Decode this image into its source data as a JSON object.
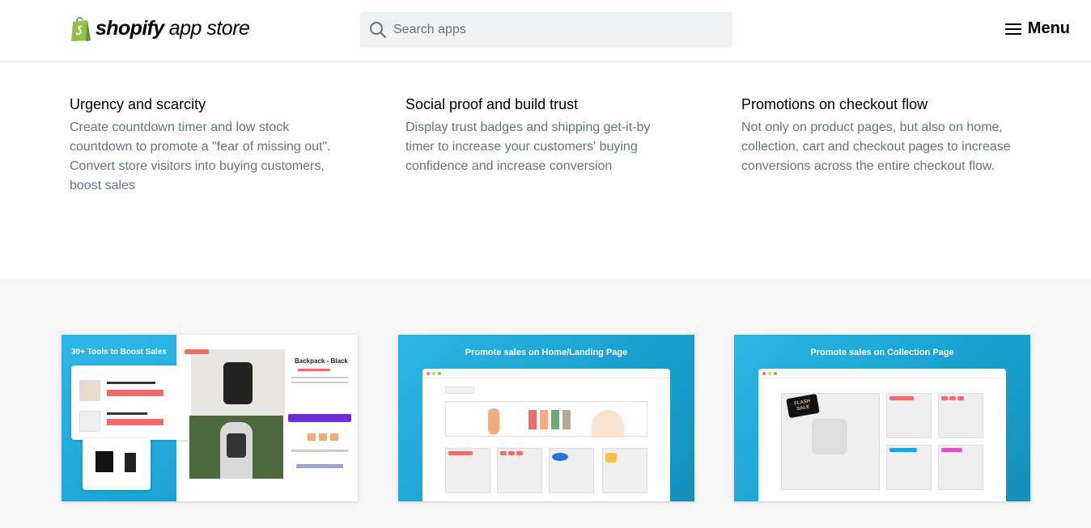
{
  "header": {
    "logo_word": "shopify",
    "logo_sub": "app store",
    "search_placeholder": "Search apps",
    "menu_label": "Menu"
  },
  "features": [
    {
      "title": "Urgency and scarcity",
      "body": "Create countdown timer and low stock countdown to promote a \"fear of missing out\". Convert store visitors into buying customers, boost sales"
    },
    {
      "title": "Social proof and build trust",
      "body": "Display trust badges and shipping get-it-by timer to increase your customers' buying confidence and increase conversion"
    },
    {
      "title": "Promotions on checkout flow",
      "body": "Not only on product pages, but also on home, collection, cart and checkout pages to increase conversions across the entire checkout flow."
    }
  ],
  "gallery": {
    "cards": [
      {
        "title": "30+ Tools to Boost Sales",
        "product_title": "Backpack - Black"
      },
      {
        "title": "Promote sales on Home/Landing Page"
      },
      {
        "title": "Promote sales on Collection Page",
        "sticker": "FLASH SALE"
      }
    ]
  },
  "colors": {
    "brand_green": "#95bf47",
    "card_blue": "#1ba5d6",
    "accent_purple": "#6d2bd9",
    "badge_red": "#f26b6b"
  }
}
